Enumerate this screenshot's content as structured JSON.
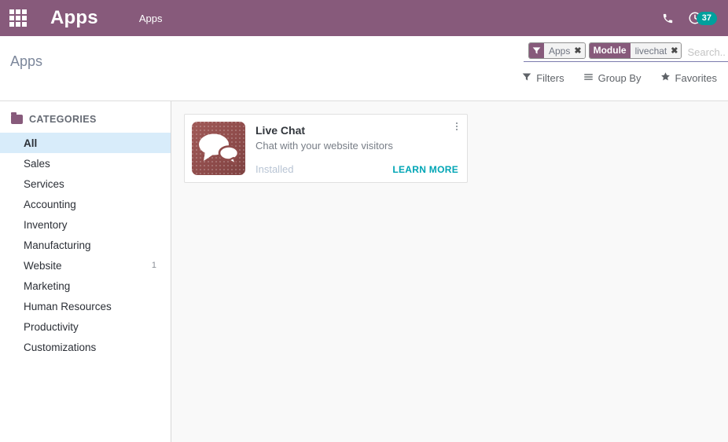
{
  "topbar": {
    "apps_grid_icon": "grid-menu-icon",
    "brand": "Apps",
    "current_menu": "Apps",
    "phone_icon": "phone-icon",
    "activity_icon": "clock-activity-icon",
    "activity_count": "37",
    "bg_color": "#875a7b",
    "badge_color": "#00a09d"
  },
  "control_panel": {
    "breadcrumb": "Apps",
    "search": {
      "placeholder": "Search...",
      "value": "",
      "facets": [
        {
          "icon": "filter-funnel-icon",
          "head": "",
          "label": "Apps",
          "remove": "✖"
        },
        {
          "icon": "",
          "head": "Module",
          "label": "livechat",
          "remove": "✖"
        }
      ]
    },
    "buttons": [
      {
        "icon": "funnel-icon",
        "label": "Filters"
      },
      {
        "icon": "list-lines-icon",
        "label": "Group By"
      },
      {
        "icon": "star-icon",
        "label": "Favorites"
      }
    ]
  },
  "sidebar": {
    "header": "CATEGORIES",
    "header_icon": "folder-icon",
    "items": [
      {
        "label": "All",
        "count": "",
        "active": true
      },
      {
        "label": "Sales",
        "count": "",
        "active": false
      },
      {
        "label": "Services",
        "count": "",
        "active": false
      },
      {
        "label": "Accounting",
        "count": "",
        "active": false
      },
      {
        "label": "Inventory",
        "count": "",
        "active": false
      },
      {
        "label": "Manufacturing",
        "count": "",
        "active": false
      },
      {
        "label": "Website",
        "count": "1",
        "active": false
      },
      {
        "label": "Marketing",
        "count": "",
        "active": false
      },
      {
        "label": "Human Resources",
        "count": "",
        "active": false
      },
      {
        "label": "Productivity",
        "count": "",
        "active": false
      },
      {
        "label": "Customizations",
        "count": "",
        "active": false
      }
    ]
  },
  "content": {
    "cards": [
      {
        "icon": "live-chat-speech-bubbles-icon",
        "icon_bg": "#8f4c4b",
        "title": "Live Chat",
        "description": "Chat with your website visitors",
        "status": "Installed",
        "action_label": "LEARN MORE",
        "action_color": "#00a5b5",
        "menu_icon": "kebab-menu-icon"
      }
    ]
  }
}
